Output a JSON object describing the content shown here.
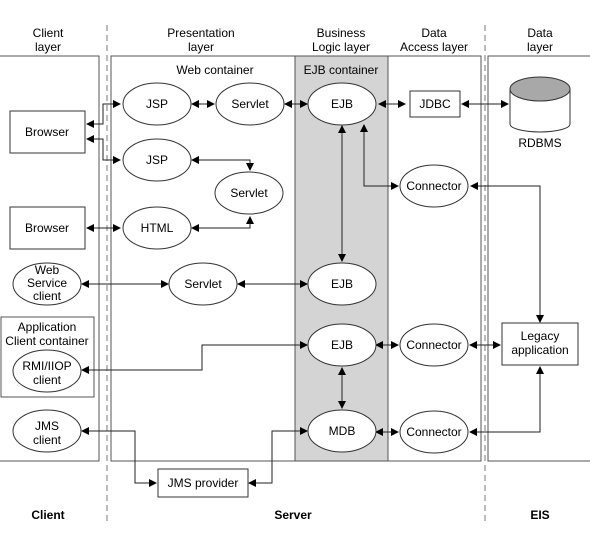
{
  "headers": {
    "client_layer": [
      "Client",
      "layer"
    ],
    "presentation_layer": [
      "Presentation",
      "layer"
    ],
    "business_logic_layer": [
      "Business",
      "Logic layer"
    ],
    "data_access_layer": [
      "Data",
      "Access layer"
    ],
    "data_layer": [
      "Data",
      "layer"
    ]
  },
  "containers": {
    "web": "Web container",
    "ejb": "EJB container",
    "app_client": [
      "Application",
      "Client container"
    ]
  },
  "nodes": {
    "browser1": "Browser",
    "browser2": "Browser",
    "web_service_client": [
      "Web",
      "Service",
      "client"
    ],
    "rmi_iiop_client": [
      "RMI/IIOP",
      "client"
    ],
    "jms_client": [
      "JMS",
      "client"
    ],
    "jsp1": "JSP",
    "servlet1": "Servlet",
    "jsp2": "JSP",
    "servlet2": "Servlet",
    "html": "HTML",
    "servlet3": "Servlet",
    "ejb1": "EJB",
    "ejb2": "EJB",
    "ejb3": "EJB",
    "mdb": "MDB",
    "jdbc": "JDBC",
    "connector1": "Connector",
    "connector2": "Connector",
    "connector3": "Connector",
    "rdbms": "RDBMS",
    "legacy": [
      "Legacy",
      "application"
    ],
    "jms_provider": "JMS provider"
  },
  "footers": {
    "client": "Client",
    "server": "Server",
    "eis": "EIS"
  },
  "colors": {
    "ejb_container_fill": "#d4d4d4",
    "rdbms_top_fill": "#a8a8a8",
    "line": "#222222"
  }
}
